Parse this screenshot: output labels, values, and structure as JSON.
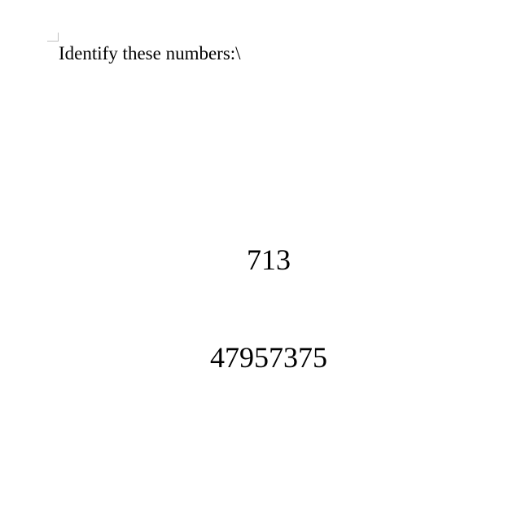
{
  "document": {
    "prompt": "Identify these numbers:\\",
    "numbers": [
      "713",
      "47957375"
    ]
  }
}
